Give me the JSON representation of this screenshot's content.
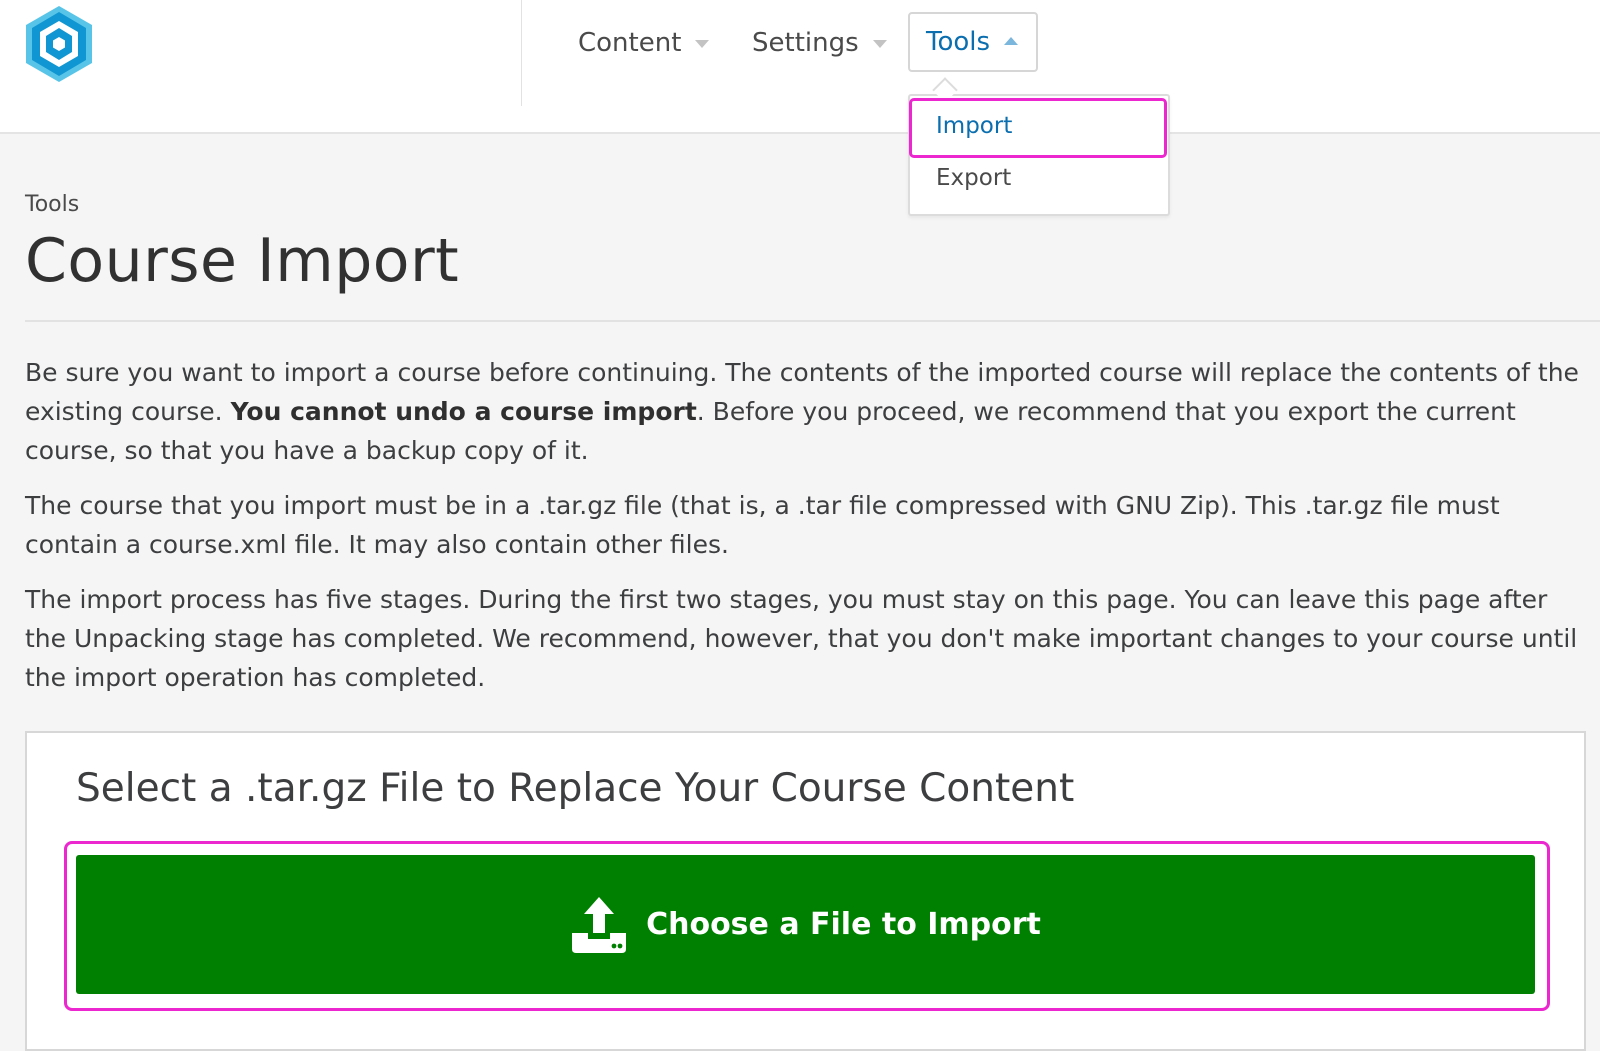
{
  "nav": {
    "items": [
      {
        "label": "Content"
      },
      {
        "label": "Settings"
      },
      {
        "label": "Tools"
      }
    ],
    "tools_menu": {
      "items": [
        {
          "label": "Import"
        },
        {
          "label": "Export"
        }
      ]
    }
  },
  "page": {
    "breadcrumb": "Tools",
    "title": "Course Import"
  },
  "intro": {
    "p1_before": "Be sure you want to import a course before continuing. The contents of the imported course will replace the contents of the existing course. ",
    "p1_bold": "You cannot undo a course import",
    "p1_after": ". Before you proceed, we recommend that you export the current course, so that you have a backup copy of it.",
    "p2": "The course that you import must be in a .tar.gz file (that is, a .tar file compressed with GNU Zip). This .tar.gz file must contain a course.xml file. It may also contain other files.",
    "p3": "The import process has five stages. During the first two stages, you must stay on this page. You can leave this page after the Unpacking stage has completed. We recommend, however, that you don't make important changes to your course until the import operation has completed."
  },
  "upload": {
    "title": "Select a .tar.gz File to Replace Your Course Content",
    "button_label": "Choose a File to Import",
    "icon": "upload-icon"
  },
  "colors": {
    "accent": "#0a6eaf",
    "primary_button": "#008000",
    "highlight": "#ec27cf",
    "logo": "#16a2d6"
  }
}
